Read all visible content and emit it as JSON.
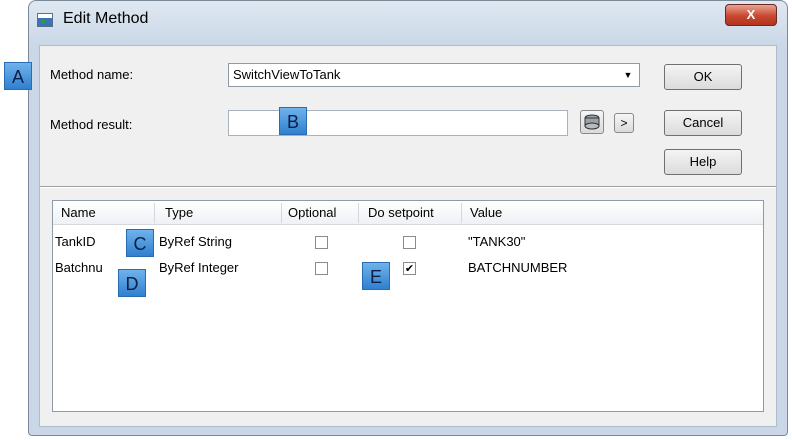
{
  "window": {
    "title": "Edit Method",
    "close_label": "X"
  },
  "form": {
    "method_name_label": "Method name:",
    "method_name_value": "SwitchViewToTank",
    "method_result_label": "Method result:",
    "method_result_value": "",
    "next_arrow": ">"
  },
  "buttons": {
    "ok": "OK",
    "cancel": "Cancel",
    "help": "Help"
  },
  "table": {
    "columns": [
      "Name",
      "Type",
      "Optional",
      "Do setpoint",
      "Value"
    ],
    "rows": [
      {
        "name": "TankID",
        "type": "ByRef String",
        "optional": false,
        "do_setpoint": false,
        "value": "\"TANK30\""
      },
      {
        "name": "Batchnu",
        "type": "ByRef Integer",
        "optional": false,
        "do_setpoint": true,
        "value": "BATCHNUMBER"
      }
    ]
  },
  "callouts": [
    "A",
    "B",
    "C",
    "D",
    "E"
  ],
  "colors": {
    "callout": "#4a94dd",
    "close_button": "#c9482f",
    "window_frame": "#c9d7e6"
  }
}
